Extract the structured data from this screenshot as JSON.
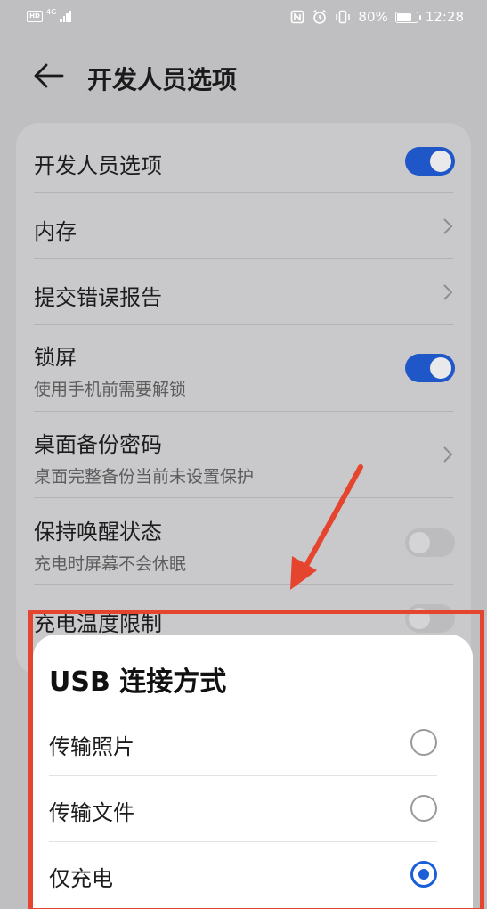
{
  "status_bar": {
    "hd_label": "HD",
    "network_type": "4G",
    "battery": "80%",
    "battery_level": 0.8,
    "time": "12:28",
    "icons": [
      "nfc-icon",
      "alarm-icon",
      "vibrate-icon",
      "battery-icon"
    ]
  },
  "header": {
    "title": "开发人员选项"
  },
  "settings": {
    "items": [
      {
        "title": "开发人员选项",
        "control": "toggle",
        "state": "on"
      },
      {
        "title": "内存",
        "control": "chevron"
      },
      {
        "title": "提交错误报告",
        "control": "chevron"
      },
      {
        "title": "锁屏",
        "subtitle": "使用手机前需要解锁",
        "control": "toggle",
        "state": "on"
      },
      {
        "title": "桌面备份密码",
        "subtitle": "桌面完整备份当前未设置保护",
        "control": "chevron"
      },
      {
        "title": "保持唤醒状态",
        "subtitle": "充电时屏幕不会休眠",
        "control": "toggle",
        "state": "off"
      },
      {
        "title": "充电温度限制",
        "control": "toggle",
        "state": "off"
      }
    ]
  },
  "usb_dialog": {
    "title": "USB 连接方式",
    "options": [
      {
        "label": "传输照片",
        "selected": false
      },
      {
        "label": "传输文件",
        "selected": false
      },
      {
        "label": "仅充电",
        "selected": true
      }
    ]
  },
  "colors": {
    "accent": "#1f56c8",
    "annotation": "#e5452e",
    "background": "#bfbfc1"
  }
}
